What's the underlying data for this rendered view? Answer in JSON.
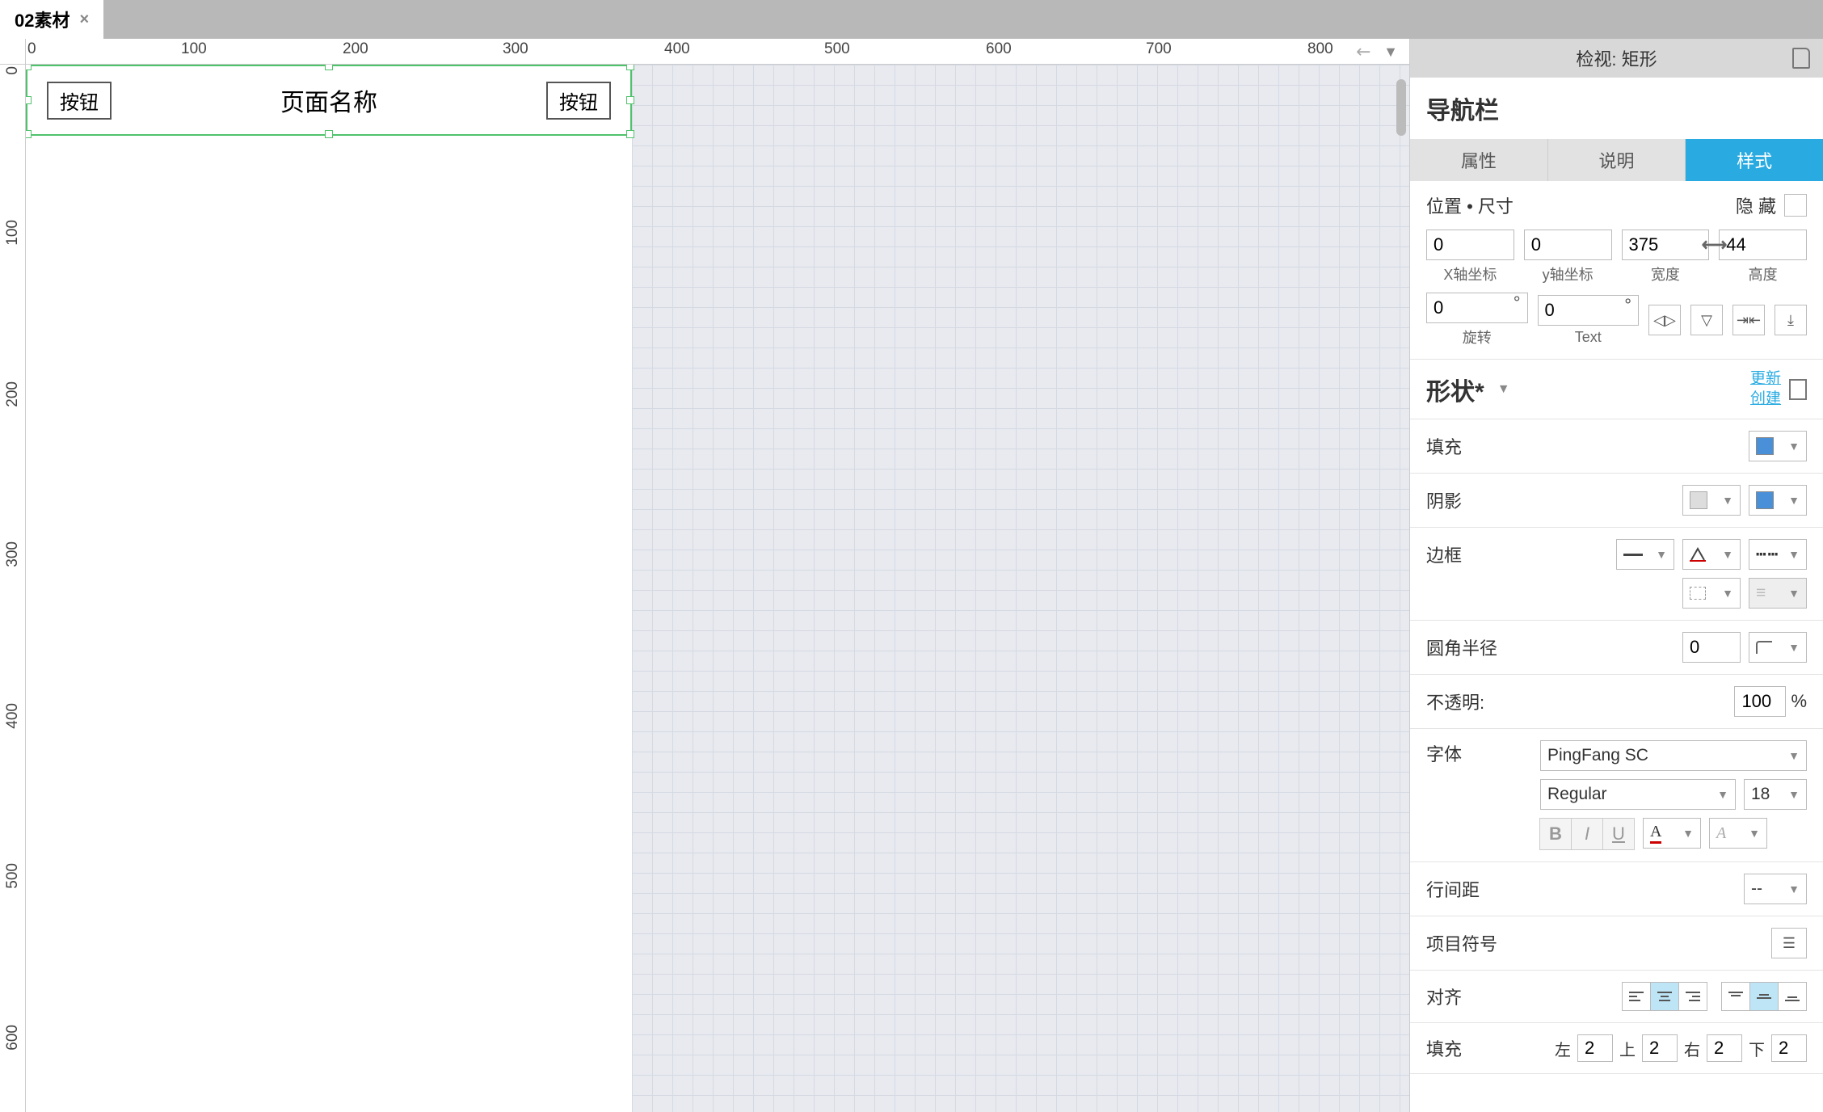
{
  "tab": {
    "name": "02素材"
  },
  "inspector": {
    "title": "检视: 矩形",
    "widgetName": "导航栏",
    "tabs": {
      "properties": "属性",
      "notes": "说明",
      "style": "样式"
    },
    "posSize": {
      "label": "位置 • 尺寸",
      "hide": "隐 藏",
      "x": "0",
      "xLabel": "X轴坐标",
      "y": "0",
      "yLabel": "y轴坐标",
      "w": "375",
      "wLabel": "宽度",
      "h": "44",
      "hLabel": "高度",
      "rot": "0",
      "rotLabel": "旋转",
      "text": "0",
      "textLabel": "Text"
    },
    "shape": {
      "label": "形状*",
      "update": "更新",
      "create": "创建"
    },
    "fill": {
      "label": "填充"
    },
    "shadow": {
      "label": "阴影"
    },
    "border": {
      "label": "边框"
    },
    "corner": {
      "label": "圆角半径",
      "value": "0"
    },
    "opacity": {
      "label": "不透明:",
      "value": "100",
      "unit": "%"
    },
    "font": {
      "label": "字体",
      "family": "PingFang SC",
      "weight": "Regular",
      "size": "18"
    },
    "lineSpacing": {
      "label": "行间距",
      "value": "--"
    },
    "bullets": {
      "label": "项目符号"
    },
    "align": {
      "label": "对齐"
    },
    "padding": {
      "label": "填充",
      "l": "左",
      "lv": "2",
      "t": "上",
      "tv": "2",
      "r": "右",
      "rv": "2",
      "b": "下",
      "bv": "2"
    }
  },
  "canvas": {
    "leftBtn": "按钮",
    "title": "页面名称",
    "rightBtn": "按钮"
  },
  "ruler": {
    "h": [
      "0",
      "100",
      "200",
      "300",
      "400",
      "500",
      "600",
      "700",
      "800"
    ],
    "v": [
      "0",
      "100",
      "200",
      "300",
      "400",
      "500",
      "600"
    ]
  }
}
